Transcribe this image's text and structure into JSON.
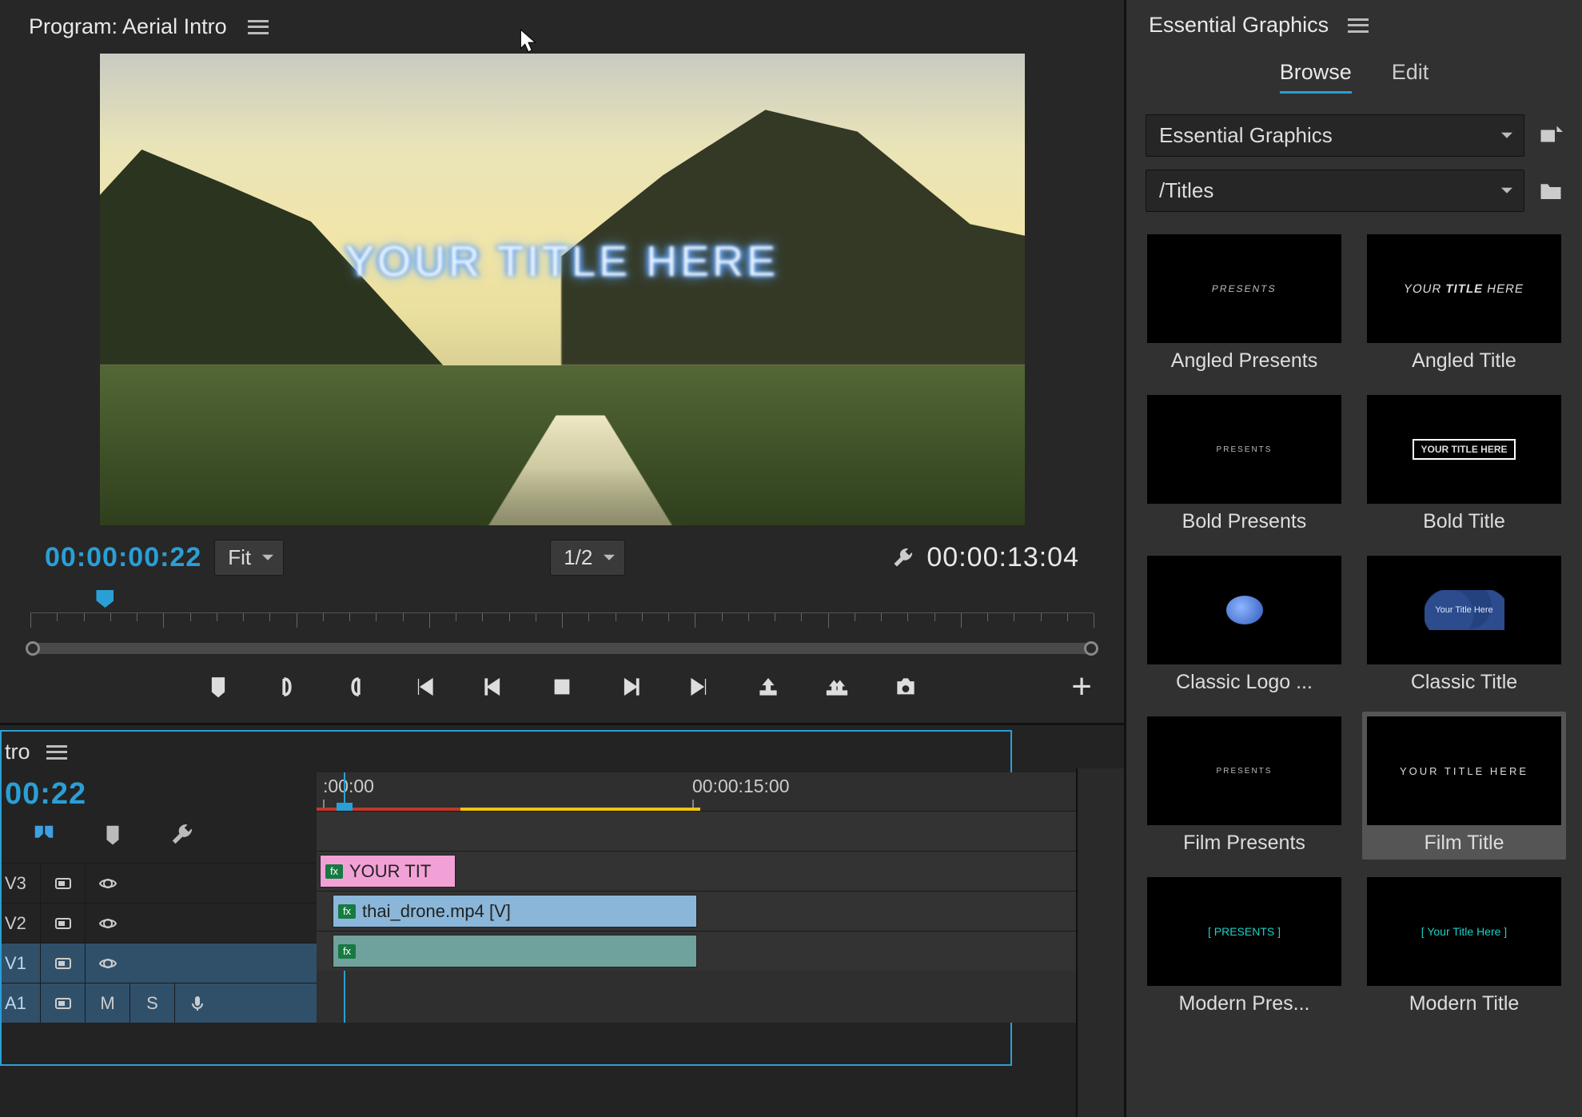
{
  "program": {
    "title": "Program: Aerial Intro",
    "preview_overlay": "YOUR TITLE HERE",
    "timecode_current": "00:00:00:22",
    "timecode_duration": "00:00:13:04",
    "zoom_fit": "Fit",
    "resolution": "1/2"
  },
  "timeline": {
    "tab_label": "tro",
    "timecode": "00:22",
    "ruler_labels": [
      ":00:00",
      "00:00:15:00"
    ],
    "tracks": [
      {
        "id": "V3",
        "selected": false
      },
      {
        "id": "V2",
        "selected": false
      },
      {
        "id": "V1",
        "selected": true
      },
      {
        "id": "A1",
        "selected": true
      }
    ],
    "clips": {
      "v2": {
        "label": "YOUR TIT"
      },
      "v1": {
        "label": "thai_drone.mp4 [V]"
      }
    },
    "audio_labels": {
      "m": "M",
      "s": "S"
    }
  },
  "eg_panel": {
    "title": "Essential Graphics",
    "tabs": {
      "browse": "Browse",
      "edit": "Edit"
    },
    "folder_dd": "Essential Graphics",
    "path_dd": "/Titles",
    "presets": [
      {
        "label": "Angled Presents",
        "thumb_text": "PRESENTS",
        "style": "angled"
      },
      {
        "label": "Angled Title",
        "thumb_text": "YOUR TITLE HERE",
        "style": "angled-bold"
      },
      {
        "label": "Bold Presents",
        "thumb_text": "PRESENTS",
        "style": "tiny"
      },
      {
        "label": "Bold Title",
        "thumb_text": "YOUR TITLE HERE",
        "style": "boxed"
      },
      {
        "label": "Classic Logo ...",
        "thumb_text": "",
        "style": "blob"
      },
      {
        "label": "Classic Title",
        "thumb_text": "Your Title Here",
        "style": "cloud"
      },
      {
        "label": "Film Presents",
        "thumb_text": "PRESENTS",
        "style": "tiny"
      },
      {
        "label": "Film Title",
        "thumb_text": "YOUR TITLE HERE",
        "style": "film",
        "selected": true
      },
      {
        "label": "Modern Pres...",
        "thumb_text": "[ PRESENTS ]",
        "style": "bracket"
      },
      {
        "label": "Modern Title",
        "thumb_text": "[ Your Title Here ]",
        "style": "bracket"
      }
    ]
  }
}
